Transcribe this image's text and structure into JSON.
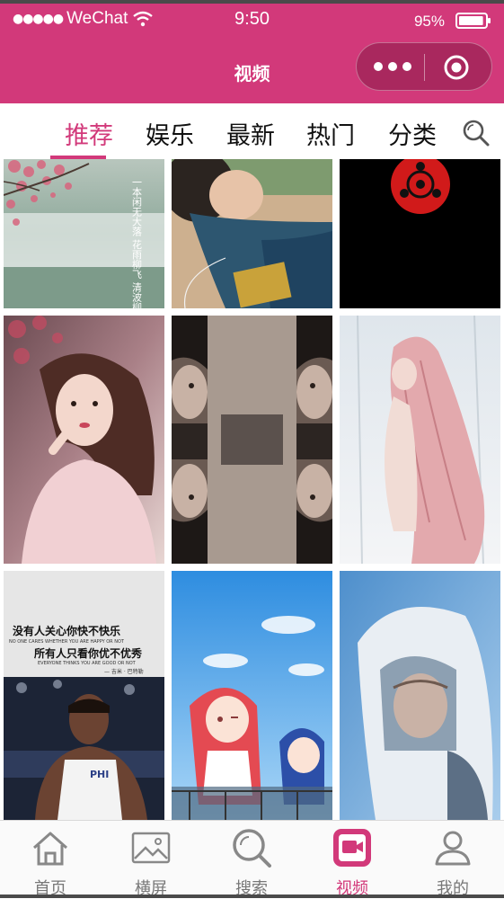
{
  "status_bar": {
    "carrier": "WeChat",
    "time": "9:50",
    "battery": "95%",
    "battery_level": 0.95
  },
  "header": {
    "title": "视频",
    "bg_color": "#d2397a"
  },
  "tabs": [
    {
      "label": "推荐",
      "active": true
    },
    {
      "label": "娱乐",
      "active": false
    },
    {
      "label": "最新",
      "active": false
    },
    {
      "label": "热门",
      "active": false
    },
    {
      "label": "分类",
      "active": false
    }
  ],
  "grid": {
    "rows": [
      [
        {
          "poem": "一本闲无大落 花雨柳飞 清波柳下参 春雨相思的"
        },
        {
          "subject": "girl-headphones"
        },
        {
          "subject": "sharingan-symbol"
        }
      ],
      [
        {
          "subject": "girl-portrait-blossom"
        },
        {
          "subject": "mirrored-faces"
        },
        {
          "subject": "pink-hair-anime-girl"
        }
      ],
      [
        {
          "caption1": "没有人关心你快不快乐",
          "caption1_en": "NO ONE CARES WHETHER YOU ARE HAPPY OR NOT",
          "caption2": "所有人只看你优不优秀",
          "caption2_en": "EVERYONE THINKS YOU ARE GOOD OR NOT",
          "caption_sign": "— 吉米 · 巴特勒",
          "jersey": "PHI"
        },
        {
          "subject": "anime-girls-sky"
        },
        {
          "subject": "hooded-assassin"
        }
      ]
    ]
  },
  "tabbar": [
    {
      "label": "首页",
      "icon": "home-icon",
      "active": false
    },
    {
      "label": "横屏",
      "icon": "image-icon",
      "active": false
    },
    {
      "label": "搜索",
      "icon": "search-icon",
      "active": false
    },
    {
      "label": "视频",
      "icon": "video-icon",
      "active": true
    },
    {
      "label": "我的",
      "icon": "user-icon",
      "active": false
    }
  ],
  "colors": {
    "accent": "#d2397a",
    "inactive": "#777777"
  }
}
